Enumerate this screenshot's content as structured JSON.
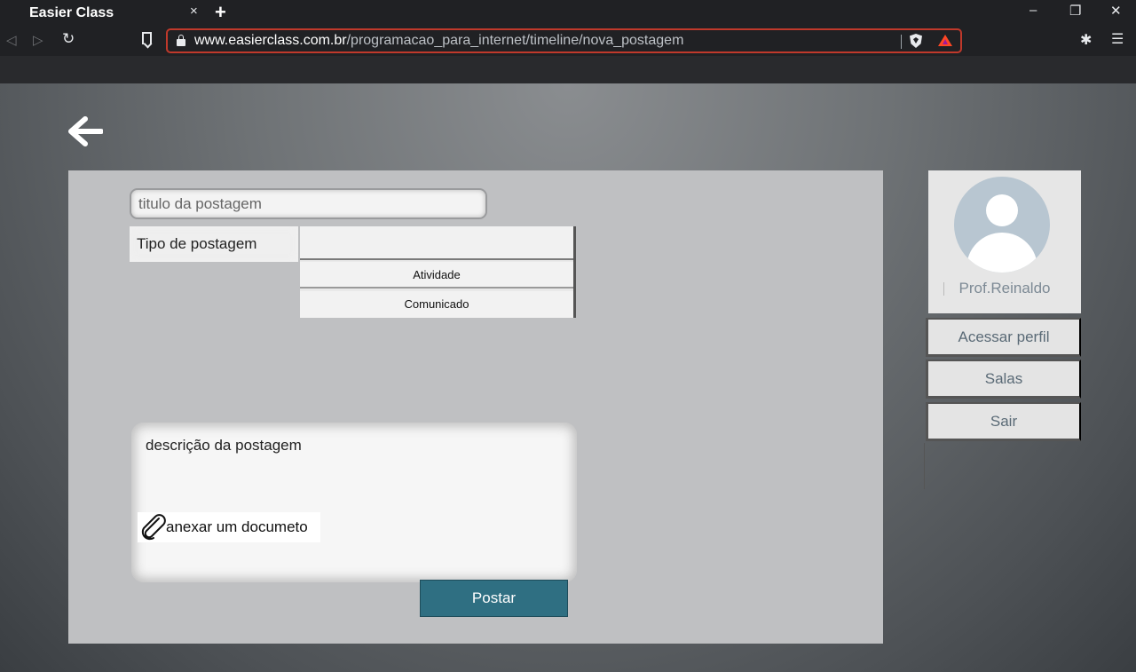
{
  "browser": {
    "tab_title": "Easier Class",
    "tab_close": "×",
    "new_tab": "+",
    "window_controls": {
      "minimize": "–",
      "restore": "❐",
      "close": "✕"
    },
    "nav": {
      "back": "◁",
      "forward": "▷",
      "reload": "C"
    },
    "url_host": "www.easierclass.com.br",
    "url_path": "/programacao_para_internet/timeline/nova_postagem",
    "menu_icon": "☰",
    "extensions_icon": "✱"
  },
  "form": {
    "title_placeholder": "titulo da postagem",
    "type_label": "Tipo de postagem",
    "type_options": [
      "Atividade",
      "Comunicado"
    ],
    "description_placeholder": "descrição da postagem",
    "attach_label": "anexar um documeto",
    "submit_label": "Postar"
  },
  "sidebar": {
    "profile_name": "Prof.Reinaldo",
    "buttons": [
      "Acessar perfil",
      "Salas",
      "Sair"
    ]
  },
  "colors": {
    "accent": "#2f6f82",
    "url_border": "#c0392b"
  }
}
